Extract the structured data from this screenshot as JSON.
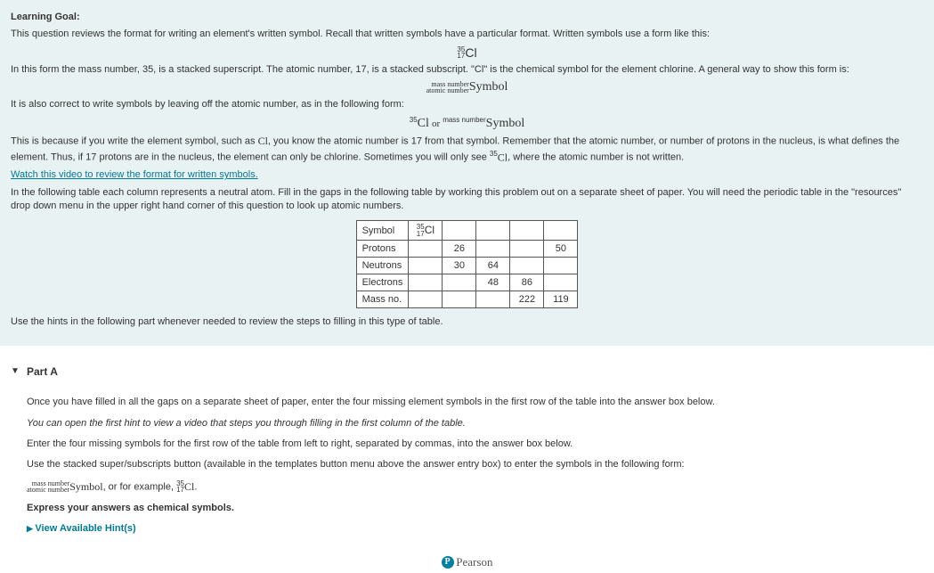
{
  "learning": {
    "heading": "Learning Goal:",
    "intro": "This question reviews the format for writing an element's written symbol. Recall that written symbols have a particular format. Written symbols use a form like this:",
    "cl_top": "35",
    "cl_bottom": "17",
    "cl_sym": "Cl",
    "para2": "In this form the mass number, 35, is a stacked superscript. The atomic number, 17, is a stacked subscript. \"Cl\" is the chemical symbol for the element chlorine. A general way to show this form is:",
    "gen_top": "mass number",
    "gen_bottom": "atomic number",
    "gen_sym": "Symbol",
    "para3": "It is also correct to write symbols by leaving off the atomic number, as in the following form:",
    "alt_sup": "35",
    "alt_cl": "Cl",
    "alt_or": "or",
    "alt_mass": "mass number",
    "alt_sym": "Symbol",
    "para4a": "This is because if you write the element symbol, such as ",
    "para4_cl": "Cl",
    "para4b": ", you know the atomic number is 17 from that symbol. Remember that the atomic number, or number of protons in the nucleus, is what defines the element. Thus, if 17 protons are in the nucleus, the element can only be chlorine. Sometimes you will only see ",
    "para4_sup": "35",
    "para4_cl2": "Cl",
    "para4c": ", where the atomic number is not written.",
    "video_link": "Watch this video to review the format for written symbols.",
    "para5": "In the following table each column represents a neutral atom. Fill in the gaps in the following table by working this problem out on a separate sheet of paper. You will need the periodic table in the \"resources\" drop down menu in the upper right hand corner of this question to look up atomic numbers.",
    "para6": "Use the hints in the following part whenever needed to review the steps to filling in this type of table."
  },
  "table": {
    "rows": [
      "Symbol",
      "Protons",
      "Neutrons",
      "Electrons",
      "Mass no."
    ],
    "symbol_cell": {
      "top": "35",
      "bottom": "17",
      "sym": "Cl"
    },
    "protons": [
      "",
      "26",
      "",
      "",
      "50"
    ],
    "neutrons": [
      "",
      "30",
      "64",
      "",
      ""
    ],
    "electrons": [
      "",
      "",
      "48",
      "86",
      ""
    ],
    "massno": [
      "",
      "",
      "",
      "222",
      "119"
    ]
  },
  "partA": {
    "title": "Part A",
    "p1": "Once you have filled in all the gaps on a separate sheet of paper, enter the four missing element symbols in the first row of the table into the answer box below.",
    "p2": "You can open the first hint to view a video that steps you through filling in the first column of the table.",
    "p3": "Enter the four missing symbols for the first row of the table from left to right, separated by commas, into the answer box below.",
    "p4": "Use the stacked super/subscripts button (available in the templates button menu above the answer entry box) to enter the symbols in the following form:",
    "p5_top": "mass number",
    "p5_bottom": "atomic number",
    "p5_sym": "Symbol",
    "p5_mid": ", or for example, ",
    "p5_cl_top": "35",
    "p5_cl_bottom": "17",
    "p5_cl_sym": "Cl",
    "p5_end": ".",
    "p6": "Express your answers as chemical symbols.",
    "hints": "View Available Hint(s)"
  },
  "footer": {
    "logo": "P",
    "brand": "Pearson"
  }
}
